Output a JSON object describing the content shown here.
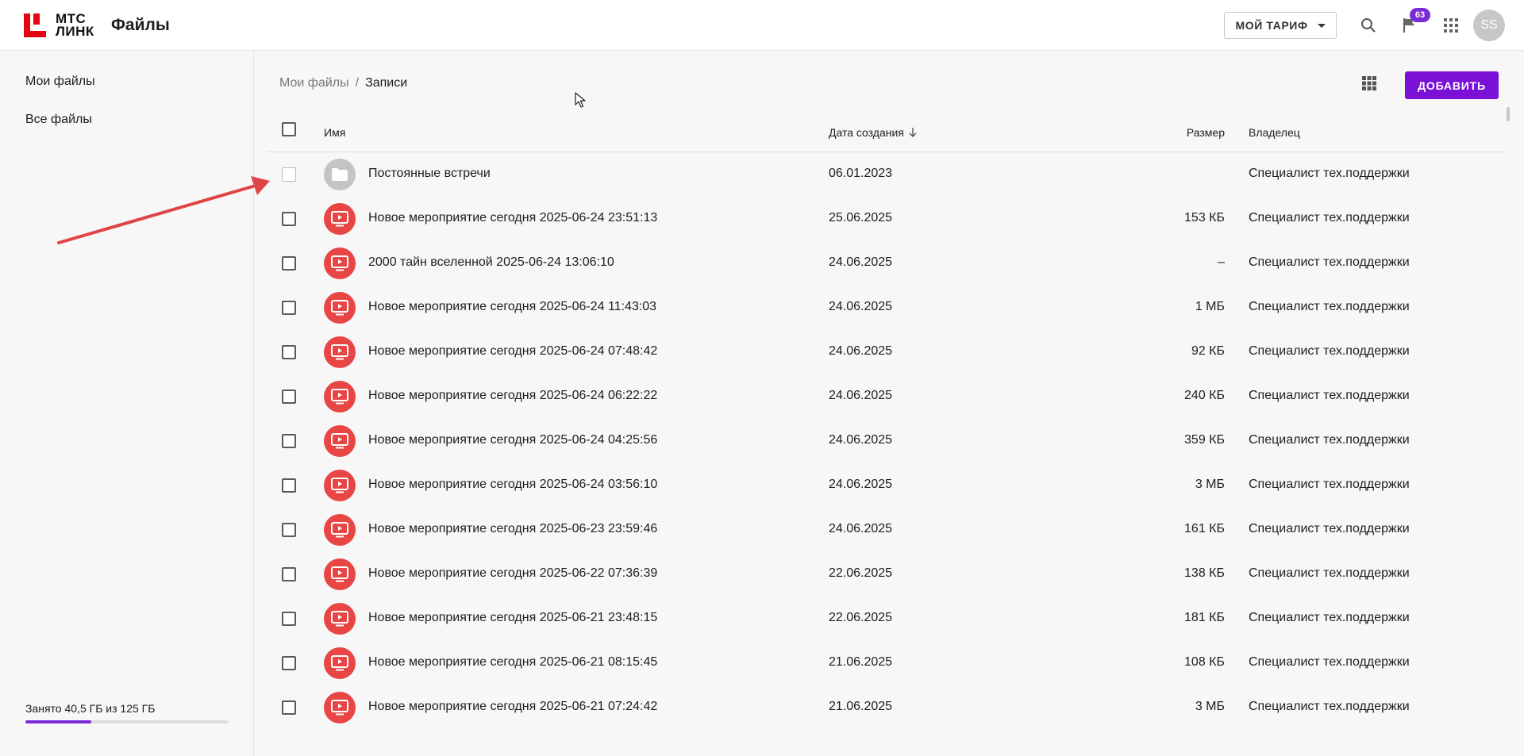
{
  "header": {
    "logo_line1": "МТС",
    "logo_line2": "ЛИНК",
    "app_title": "Файлы",
    "tariff_label": "МОЙ ТАРИФ",
    "notifications_count": "63",
    "avatar_initials": "SS",
    "accent_color": "#7b2bd6"
  },
  "sidebar": {
    "items": [
      {
        "label": "Мои файлы"
      },
      {
        "label": "Все файлы"
      }
    ],
    "storage_text": "Занято 40,5 ГБ из 125 ГБ",
    "storage_used_fraction": 0.324
  },
  "breadcrumb": {
    "parent": "Мои файлы",
    "separator": "/",
    "current": "Записи"
  },
  "toolbar": {
    "add_label": "ДОБАВИТЬ",
    "view_icon": "grid-view-icon"
  },
  "table": {
    "columns": {
      "name": "Имя",
      "created": "Дата создания",
      "size": "Размер",
      "owner": "Владелец"
    },
    "rows": [
      {
        "type": "folder",
        "name": "Постоянные встречи",
        "date": "06.01.2023",
        "size": "",
        "owner": "Специалист тех.поддержки"
      },
      {
        "type": "recording",
        "name": "Новое мероприятие сегодня 2025-06-24 23:51:13",
        "date": "25.06.2025",
        "size": "153 КБ",
        "owner": "Специалист тех.поддержки"
      },
      {
        "type": "recording",
        "name": "2000 тайн вселенной 2025-06-24 13:06:10",
        "date": "24.06.2025",
        "size": "–",
        "owner": "Специалист тех.поддержки"
      },
      {
        "type": "recording",
        "name": "Новое мероприятие сегодня 2025-06-24 11:43:03",
        "date": "24.06.2025",
        "size": "1 МБ",
        "owner": "Специалист тех.поддержки"
      },
      {
        "type": "recording",
        "name": "Новое мероприятие сегодня 2025-06-24 07:48:42",
        "date": "24.06.2025",
        "size": "92 КБ",
        "owner": "Специалист тех.поддержки"
      },
      {
        "type": "recording",
        "name": "Новое мероприятие сегодня 2025-06-24 06:22:22",
        "date": "24.06.2025",
        "size": "240 КБ",
        "owner": "Специалист тех.поддержки"
      },
      {
        "type": "recording",
        "name": "Новое мероприятие сегодня 2025-06-24 04:25:56",
        "date": "24.06.2025",
        "size": "359 КБ",
        "owner": "Специалист тех.поддержки"
      },
      {
        "type": "recording",
        "name": "Новое мероприятие сегодня 2025-06-24 03:56:10",
        "date": "24.06.2025",
        "size": "3 МБ",
        "owner": "Специалист тех.поддержки"
      },
      {
        "type": "recording",
        "name": "Новое мероприятие сегодня 2025-06-23 23:59:46",
        "date": "24.06.2025",
        "size": "161 КБ",
        "owner": "Специалист тех.поддержки"
      },
      {
        "type": "recording",
        "name": "Новое мероприятие сегодня 2025-06-22 07:36:39",
        "date": "22.06.2025",
        "size": "138 КБ",
        "owner": "Специалист тех.поддержки"
      },
      {
        "type": "recording",
        "name": "Новое мероприятие сегодня 2025-06-21 23:48:15",
        "date": "22.06.2025",
        "size": "181 КБ",
        "owner": "Специалист тех.поддержки"
      },
      {
        "type": "recording",
        "name": "Новое мероприятие сегодня 2025-06-21 08:15:45",
        "date": "21.06.2025",
        "size": "108 КБ",
        "owner": "Специалист тех.поддержки"
      },
      {
        "type": "recording",
        "name": "Новое мероприятие сегодня 2025-06-21 07:24:42",
        "date": "21.06.2025",
        "size": "3 МБ",
        "owner": "Специалист тех.поддержки"
      }
    ]
  },
  "colors": {
    "recording_icon": "#e84545",
    "folder_icon": "#c4c4c4",
    "annotation_arrow": "#e04545"
  }
}
